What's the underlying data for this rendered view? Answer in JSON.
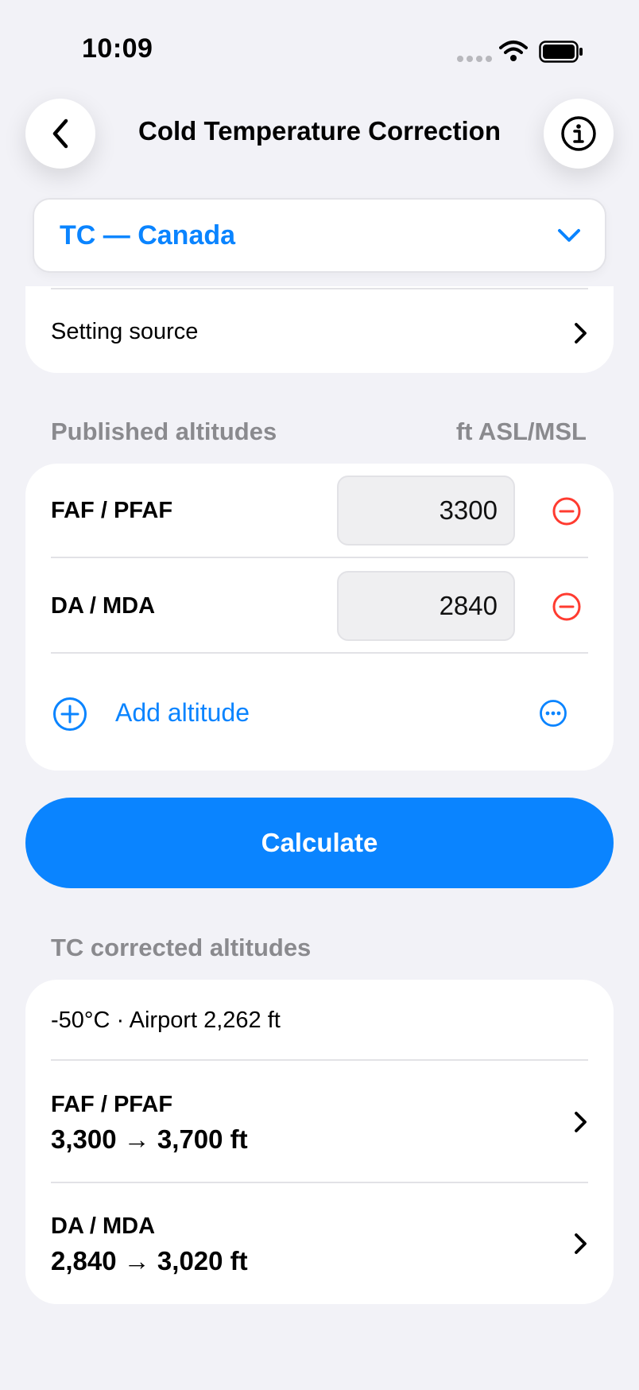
{
  "status": {
    "time": "10:09"
  },
  "nav": {
    "title": "Cold Temperature Correction"
  },
  "authority": {
    "selected": "TC — Canada"
  },
  "setting": {
    "label": "Setting source"
  },
  "published": {
    "header": "Published altitudes",
    "units": "ft ASL/MSL",
    "rows": [
      {
        "label": "FAF / PFAF",
        "value": "3300"
      },
      {
        "label": "DA / MDA",
        "value": "2840"
      }
    ],
    "add_label": "Add altitude"
  },
  "calculate": {
    "label": "Calculate"
  },
  "corrected": {
    "header": "TC corrected altitudes",
    "context": "-50°C · Airport 2,262 ft",
    "rows": [
      {
        "name": "FAF / PFAF",
        "value": "3,300 → 3,700 ft"
      },
      {
        "name": "DA / MDA",
        "value": "2,840 → 3,020 ft"
      }
    ]
  },
  "colors": {
    "accent": "#0a84ff",
    "destructive": "#ff3b30",
    "background": "#f2f2f7"
  },
  "icons": [
    "back-chevron-icon",
    "info-icon",
    "chevron-down-icon",
    "chevron-right-icon",
    "minus-circle-icon",
    "plus-circle-icon",
    "ellipsis-circle-icon",
    "wifi-icon",
    "battery-icon"
  ]
}
